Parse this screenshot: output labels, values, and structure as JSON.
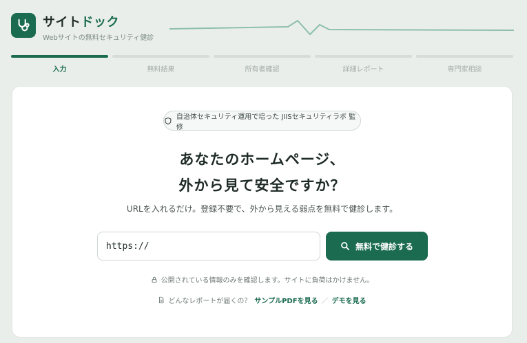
{
  "header": {
    "brand_part1": "サイト",
    "brand_part2": "ドック",
    "tagline": "Webサイトの無料セキュリティ健診"
  },
  "steps": [
    {
      "label": "入力",
      "active": true
    },
    {
      "label": "無料結果",
      "active": false
    },
    {
      "label": "所有者確認",
      "active": false
    },
    {
      "label": "詳細レポート",
      "active": false
    },
    {
      "label": "専門家相談",
      "active": false
    }
  ],
  "badge": {
    "text": "自治体セキュリティ運用で培った JIISセキュリティラボ 監修",
    "icon": "shield-icon"
  },
  "headline": {
    "line1": "あなたのホームページ、",
    "line2": "外から見て安全ですか？"
  },
  "subtext": "URLを入れるだけ。登録不要で、外から見える弱点を無料で健診します。",
  "form": {
    "url_value": "https://",
    "button_label": "無料で健診する"
  },
  "note": "公開されている情報のみを確認します。サイトに負荷はかけません。",
  "links": {
    "prefix": "どんなレポートが届くの？",
    "sample_pdf": "サンプルPDFを見る",
    "separator": "／",
    "demo": "デモを見る"
  },
  "colors": {
    "accent": "#1a6b50",
    "background": "#e9eeeb"
  }
}
